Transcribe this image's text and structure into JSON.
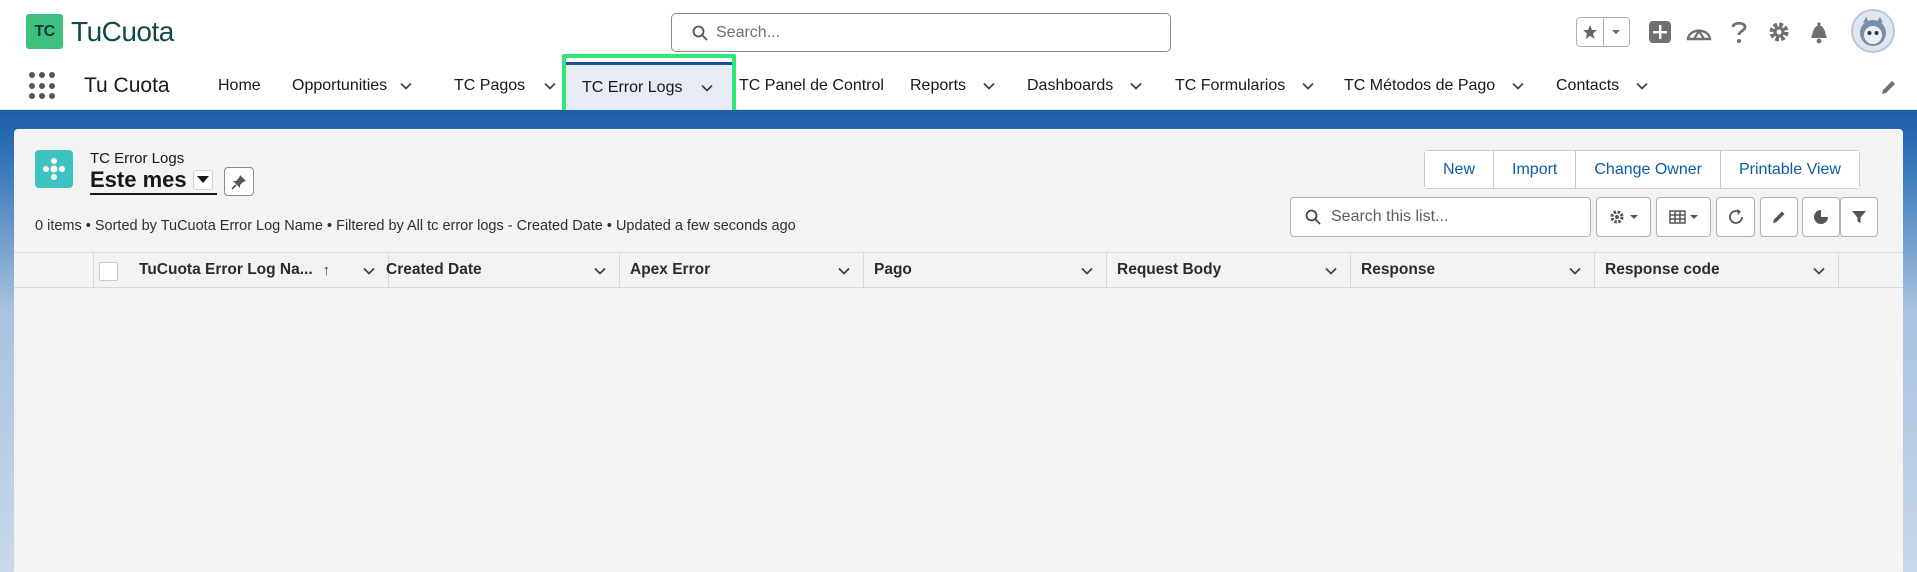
{
  "brand": {
    "mark": "TC",
    "name": "TuCuota",
    "mark_color": "#3dc07e"
  },
  "global_search": {
    "placeholder": "Search..."
  },
  "app": {
    "name": "Tu Cuota"
  },
  "nav": {
    "items": [
      {
        "label": "Home",
        "has_menu": false
      },
      {
        "label": "Opportunities",
        "has_menu": true
      },
      {
        "label": "TC Pagos",
        "has_menu": true
      },
      {
        "label": "TC Error Logs",
        "has_menu": true,
        "active": true
      },
      {
        "label": "TC Panel de Control",
        "has_menu": false
      },
      {
        "label": "Reports",
        "has_menu": true
      },
      {
        "label": "Dashboards",
        "has_menu": true
      },
      {
        "label": "TC Formularios",
        "has_menu": true
      },
      {
        "label": "TC Métodos de Pago",
        "has_menu": true
      },
      {
        "label": "Contacts",
        "has_menu": true
      }
    ],
    "active_color": "#1b5297",
    "highlight_color": "#2ee87a"
  },
  "list_view": {
    "object_label": "TC Error Logs",
    "view_name": "Este mes",
    "status": "0 items • Sorted by TuCuota Error Log Name • Filtered by All tc error logs - Created Date • Updated a few seconds ago",
    "actions": [
      "New",
      "Import",
      "Change Owner",
      "Printable View"
    ],
    "search_placeholder": "Search this list...",
    "columns": [
      {
        "label": "TuCuota Error Log Na...",
        "sorted": "ascending"
      },
      {
        "label": "Created Date"
      },
      {
        "label": "Apex Error"
      },
      {
        "label": "Pago"
      },
      {
        "label": "Request Body"
      },
      {
        "label": "Response"
      },
      {
        "label": "Response code"
      }
    ],
    "rows": []
  },
  "icons": [
    "search-icon",
    "favorites-star-icon",
    "chevron-down-icon",
    "add-icon",
    "trailhead-icon",
    "help-icon",
    "gear-icon",
    "bell-icon",
    "avatar",
    "app-launcher-icon",
    "edit-nav-icon",
    "object-icon",
    "pin-icon",
    "list-settings-icon",
    "table-view-icon",
    "refresh-icon",
    "edit-icon",
    "chart-icon",
    "filter-icon"
  ],
  "accent_link_color": "#0b5cab"
}
